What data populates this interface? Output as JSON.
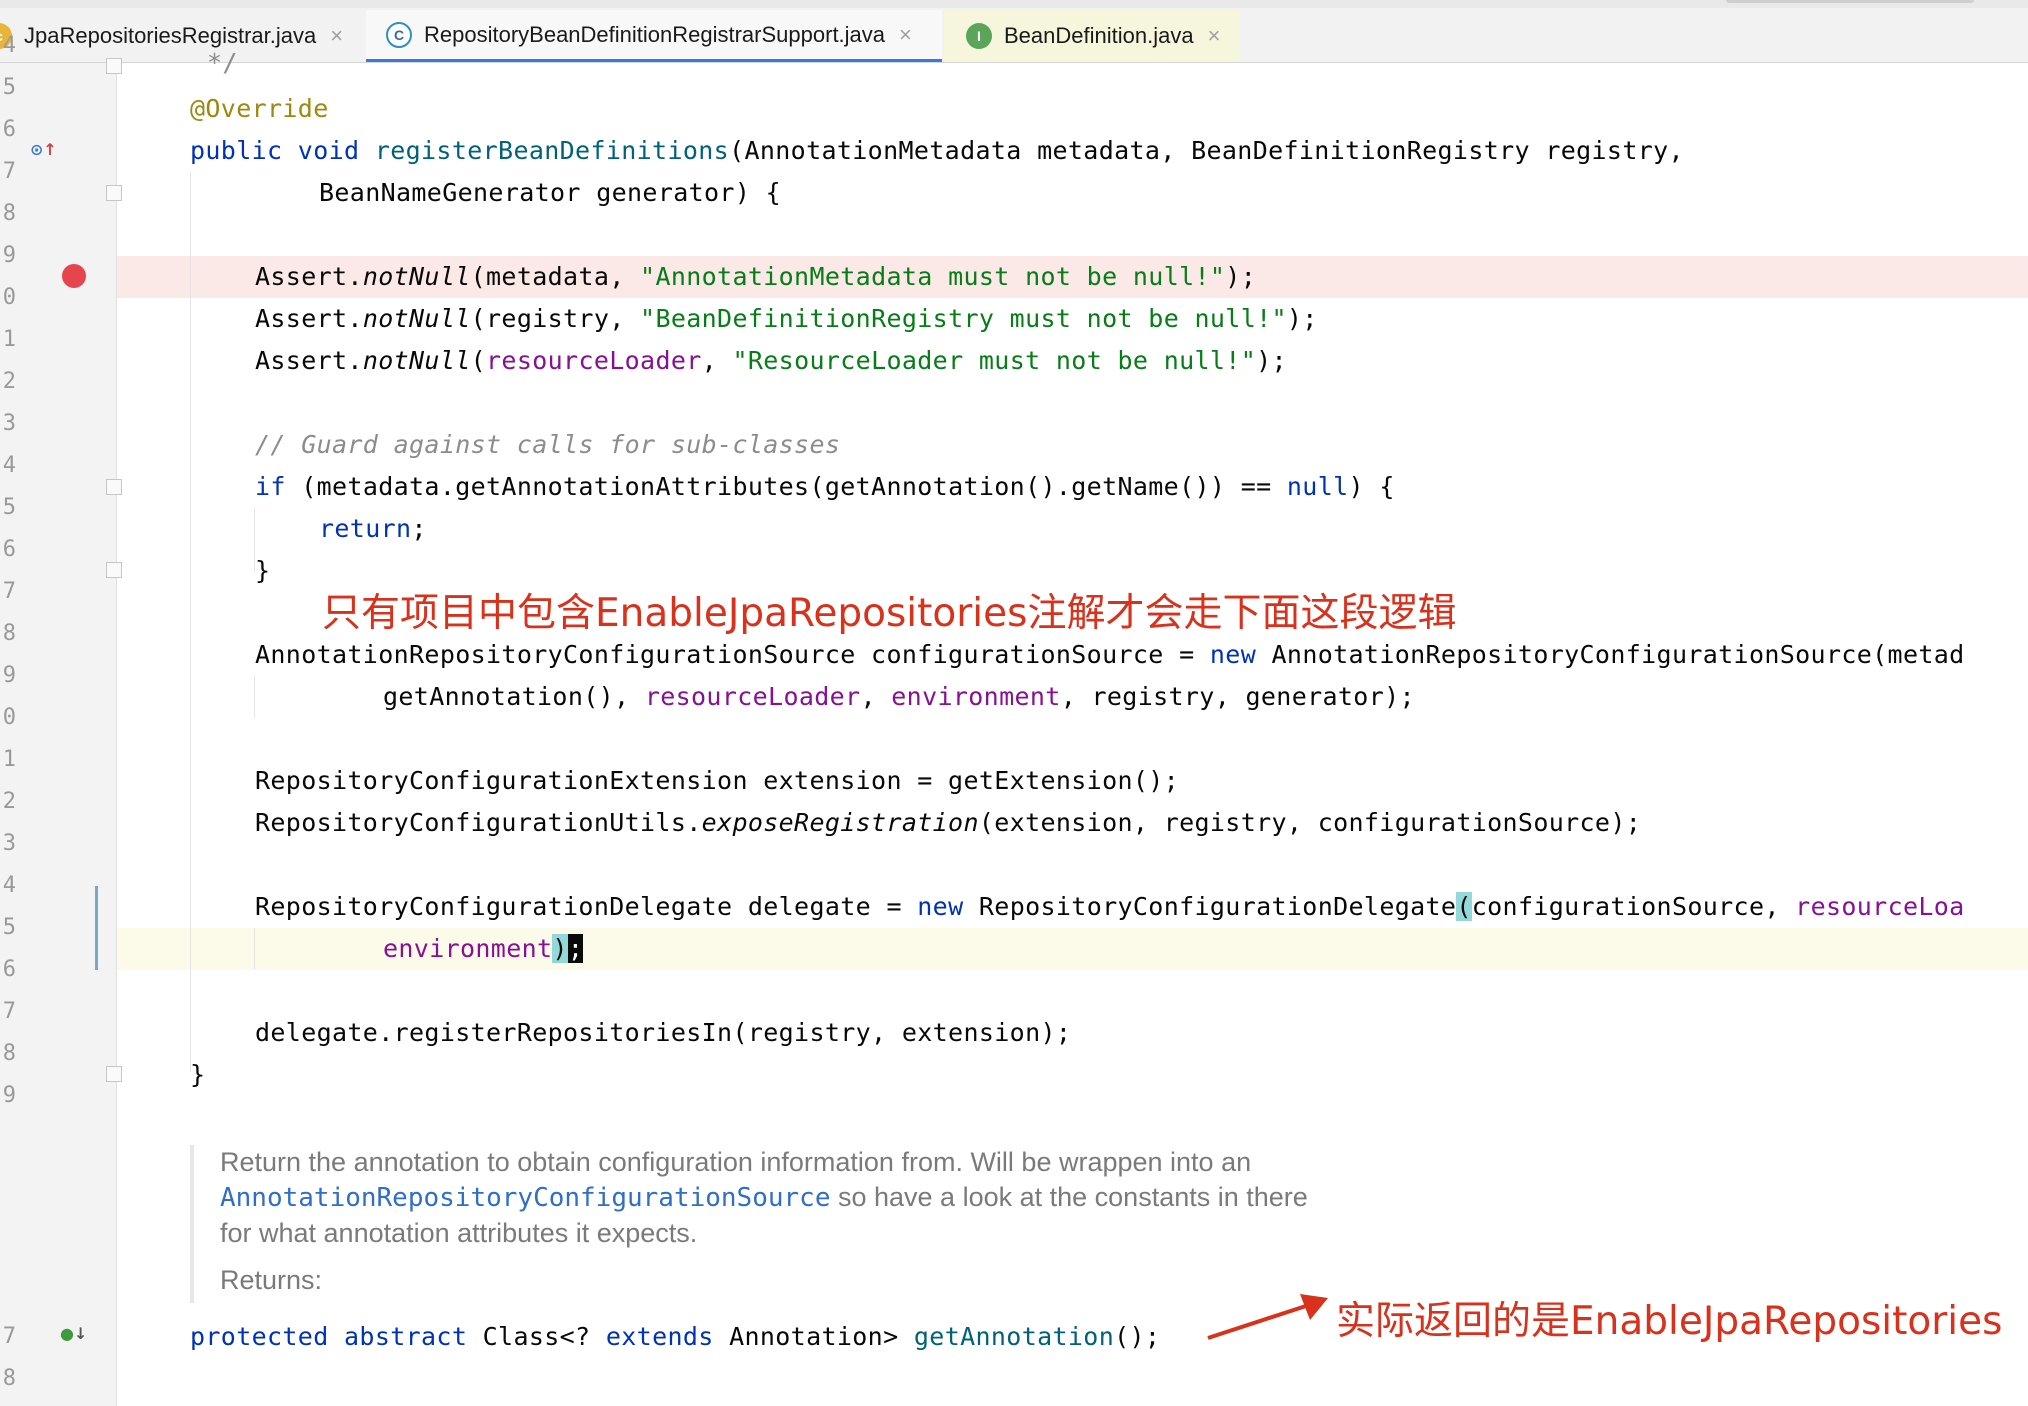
{
  "tabs": [
    {
      "label": "JpaRepositoriesRegistrar.java",
      "icon": "c"
    },
    {
      "label": "RepositoryBeanDefinitionRegistrarSupport.java",
      "icon": "C"
    },
    {
      "label": "BeanDefinition.java",
      "icon": "I"
    }
  ],
  "close_glyph": "×",
  "gutter": {
    "line_numbers": [
      "4",
      "5",
      "6",
      "7",
      "8",
      "9",
      "0",
      "1",
      "2",
      "3",
      "4",
      "5",
      "6",
      "7",
      "8",
      "9",
      "0",
      "1",
      "2",
      "3",
      "4",
      "5",
      "6",
      "7",
      "8",
      "9"
    ],
    "bottom_numbers": [
      "7",
      "8"
    ]
  },
  "code": {
    "l0": "*/",
    "l1_ann": "@Override",
    "l2_kw": "public void",
    "l2_mth": "registerBeanDefinitions",
    "l2_rest": "(AnnotationMetadata metadata, BeanDefinitionRegistry registry,",
    "l3": "BeanNameGenerator generator) {",
    "l5_a": "Assert.",
    "l5_m": "notNull",
    "l5_b": "(metadata, ",
    "l5_s": "\"AnnotationMetadata must not be null!\"",
    "l5_c": ");",
    "l6_b": "(registry, ",
    "l6_s": "\"BeanDefinitionRegistry must not be null!\"",
    "l7_b": "(",
    "l7_f": "resourceLoader",
    "l7_c": ", ",
    "l7_s": "\"ResourceLoader must not be null!\"",
    "l9": "// Guard against calls for sub-classes",
    "l10_kw": "if",
    "l10_a": " (metadata.getAnnotationAttributes(getAnnotation().getName()) == ",
    "l10_null": "null",
    "l10_b": ") {",
    "l11": "return",
    "l11_end": ";",
    "l12": "}",
    "l14_a": "AnnotationRepositoryConfigurationSource configurationSource = ",
    "l14_new": "new",
    "l14_b": " AnnotationRepositoryConfigurationSource(metad",
    "l15_a": "getAnnotation(), ",
    "l15_f1": "resourceLoader",
    "l15_sep": ", ",
    "l15_f2": "environment",
    "l15_b": ", registry, generator);",
    "l17": "RepositoryConfigurationExtension extension = getExtension();",
    "l18_a": "RepositoryConfigurationUtils.",
    "l18_m": "exposeRegistration",
    "l18_b": "(extension, registry, configurationSource);",
    "l20_a": "RepositoryConfigurationDelegate delegate = ",
    "l20_new": "new",
    "l20_b": " RepositoryConfigurationDelegate",
    "l20_paren": "(",
    "l20_c": "configurationSource, ",
    "l20_f": "resourceLoa",
    "l21_f": "environment",
    "l21_paren": ")",
    "l21_semi": ";",
    "l23": "delegate.registerRepositoriesIn(registry, extension);",
    "l24": "}",
    "l_last_kw": "protected abstract",
    "l_last_a": " Class<? ",
    "l_last_kw2": "extends",
    "l_last_b": " Annotation> ",
    "l_last_m": "getAnnotation",
    "l_last_c": "();"
  },
  "doc": {
    "line1": "Return the annotation to obtain configuration information from. Will be wrappen into an",
    "link": "AnnotationRepositoryConfigurationSource",
    "line2_rest": " so have a look at the constants in there",
    "line3": "for what annotation attributes it expects.",
    "returns": "Returns:"
  },
  "annotations": {
    "note1": "只有项目中包含EnableJpaRepositories注解才会走下面这段逻辑",
    "note2": "实际返回的是EnableJpaRepositories"
  },
  "colors": {
    "keyword": "#0033b3",
    "string": "#067d17",
    "field": "#871094",
    "annotation_text": "#d8321d"
  }
}
